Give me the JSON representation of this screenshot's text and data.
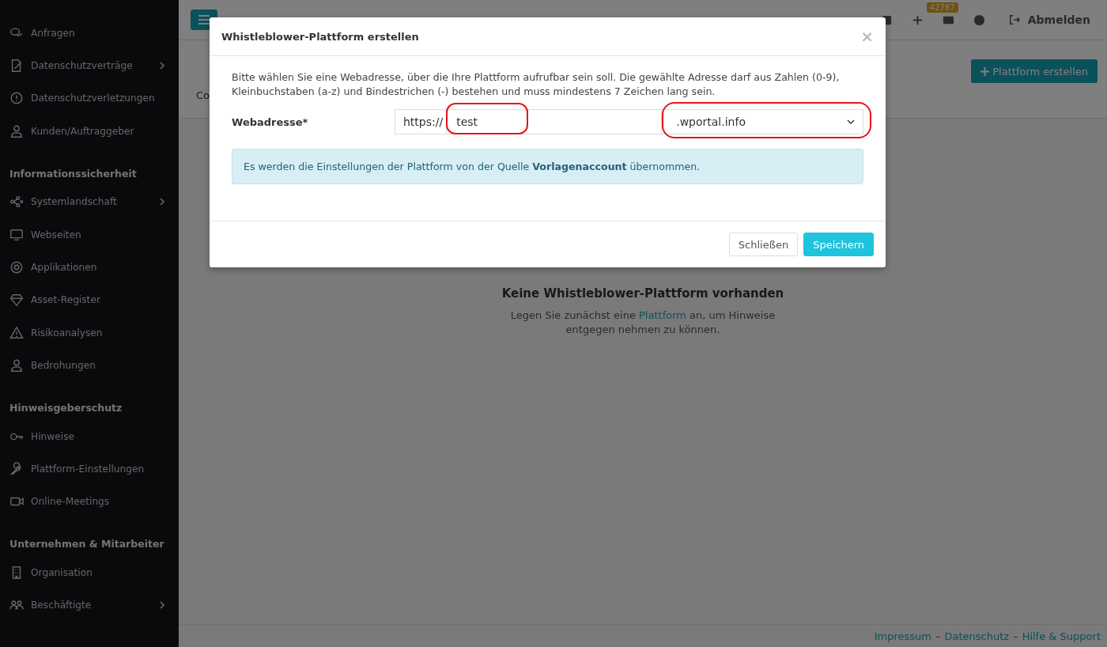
{
  "sidebar": {
    "sections": [
      {
        "items": [
          {
            "label": "Anfragen",
            "submenu": false
          },
          {
            "label": "Datenschutzverträge",
            "submenu": true
          },
          {
            "label": "Datenschutzverletzungen",
            "submenu": false
          },
          {
            "label": "Kunden/Auftraggeber",
            "submenu": false
          }
        ]
      },
      {
        "title": "Informationssicherheit",
        "items": [
          {
            "label": "Systemlandschaft",
            "submenu": true
          },
          {
            "label": "Webseiten",
            "submenu": false
          },
          {
            "label": "Applikationen",
            "submenu": false
          },
          {
            "label": "Asset-Register",
            "submenu": false
          },
          {
            "label": "Risikoanalysen",
            "submenu": false
          },
          {
            "label": "Bedrohungen",
            "submenu": false
          }
        ]
      },
      {
        "title": "Hinweisgeberschutz",
        "items": [
          {
            "label": "Hinweise",
            "submenu": false
          },
          {
            "label": "Plattform-Einstellungen",
            "submenu": false
          },
          {
            "label": "Online-Meetings",
            "submenu": false
          }
        ]
      },
      {
        "title": "Unternehmen & Mitarbeiter",
        "items": [
          {
            "label": "Organisation",
            "submenu": false
          },
          {
            "label": "Beschäftigte",
            "submenu": true
          }
        ]
      }
    ]
  },
  "topbar": {
    "badge": "42787",
    "logout": "Abmelden"
  },
  "page": {
    "tab": "Co",
    "create_button": "Plattform erstellen",
    "empty_title": "Keine Whistleblower-Plattform vorhanden",
    "empty_text_before": "Legen Sie zunächst eine",
    "empty_link": "Plattform",
    "empty_text_after": "an, um Hinweise entgegen nehmen zu können."
  },
  "footer": {
    "links": [
      "Impressum",
      "Datenschutz",
      "Hilfe & Support"
    ],
    "separator": "–"
  },
  "modal": {
    "title": "Whistleblower-Plattform erstellen",
    "close": "×",
    "intro": "Bitte wählen Sie eine Webadresse, über die Ihre Plattform aufrufbar sein soll. Die gewählte Adresse darf aus Zahlen (0-9), Kleinbuchstaben (a-z) und Bindestrichen (-) bestehen und muss mindestens 7 Zeichen lang sein.",
    "field_label": "Webadresse*",
    "prefix": "https://",
    "value": "test",
    "value_highlighted": true,
    "domain": ".wportal.info",
    "domain_highlighted": true,
    "info": "Es werden die Einstellungen der Plattform von der Quelle **Vorlagenaccount** übernommen.",
    "buttons": [
      {
        "label": "Schließen",
        "kind": "secondary"
      },
      {
        "label": "Speichern",
        "kind": "primary"
      }
    ]
  }
}
